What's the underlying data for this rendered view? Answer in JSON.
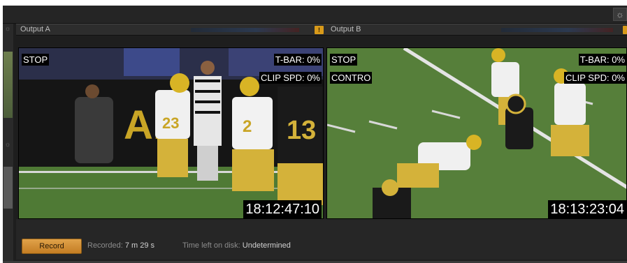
{
  "output_a": {
    "title": "Output A",
    "overlays": {
      "stop": "STOP",
      "tbar": "T-BAR: 0%",
      "clip_spd": "CLIP SPD: 0%"
    },
    "timecode": "18:12:47:10"
  },
  "output_b": {
    "title": "Output B",
    "overlays": {
      "stop": "STOP",
      "control": "CONTRO",
      "tbar": "T-BAR: 0%",
      "clip_spd": "CLIP SPD: 0%"
    },
    "timecode": "18:13:23:04"
  },
  "bottom": {
    "record_label": "Record",
    "recorded_label": "Recorded:",
    "recorded_value": "7 m 29 s",
    "time_left_label": "Time left on disk:",
    "time_left_value": "Undetermined"
  },
  "icons": {
    "top_settings": "gear-icon",
    "warning": "warning-icon"
  },
  "colors": {
    "accent": "#d89a1a",
    "background": "#1e1e1e",
    "field_green": "#4f7a35"
  }
}
